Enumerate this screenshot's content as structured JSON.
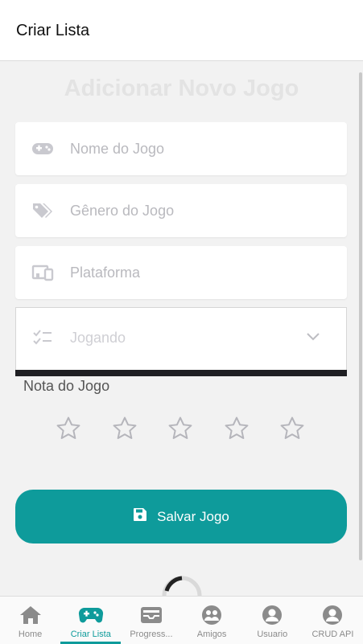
{
  "header": {
    "title": "Criar Lista"
  },
  "form": {
    "title": "Adicionar Novo Jogo",
    "fields": {
      "name": {
        "placeholder": "Nome do Jogo",
        "icon": "gamepad-icon"
      },
      "genre": {
        "placeholder": "Gênero do Jogo",
        "icon": "tags-icon"
      },
      "platform": {
        "placeholder": "Plataforma",
        "icon": "devices-icon"
      }
    },
    "status": {
      "value": "Jogando",
      "icon": "checklist-icon"
    },
    "rating": {
      "label": "Nota do Jogo",
      "max": 5,
      "value": 0
    },
    "save_label": "Salvar Jogo"
  },
  "colors": {
    "accent": "#0e9b9b",
    "inactive": "#8b8b8b"
  },
  "tabs": [
    {
      "label": "Home",
      "icon": "home-icon"
    },
    {
      "label": "Criar Lista",
      "icon": "gamepad-icon",
      "active": true
    },
    {
      "label": "Progress...",
      "icon": "inbox-icon"
    },
    {
      "label": "Amigos",
      "icon": "friends-icon"
    },
    {
      "label": "Usuario",
      "icon": "user-icon"
    },
    {
      "label": "CRUD API",
      "icon": "user-icon"
    }
  ]
}
